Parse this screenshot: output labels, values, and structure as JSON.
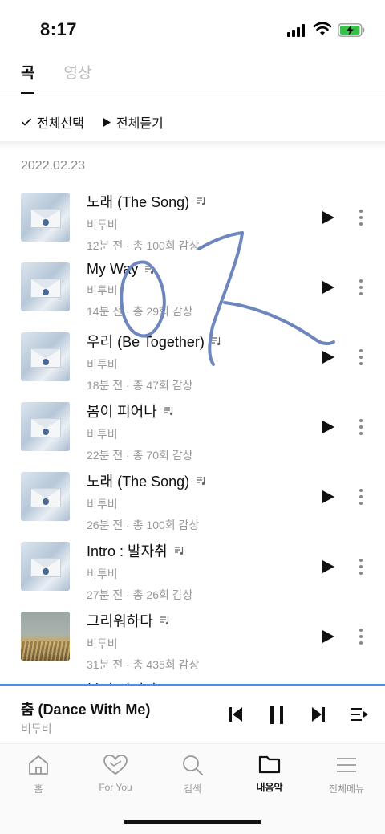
{
  "status_bar": {
    "time": "8:17"
  },
  "tabs": [
    {
      "label": "곡",
      "active": true
    },
    {
      "label": "영상",
      "active": false
    }
  ],
  "actions": {
    "select_all": "전체선택",
    "play_all": "전체듣기"
  },
  "date_header": "2022.02.23",
  "songs": [
    {
      "title": "노래 (The Song)",
      "artist": "비투비",
      "meta": "12분 전 · 총 100회 감상",
      "cover": "envelope"
    },
    {
      "title": "My Way",
      "artist": "비투비",
      "meta": "14분 전 · 총 29회 감상",
      "cover": "envelope"
    },
    {
      "title": "우리 (Be Together)",
      "artist": "비투비",
      "meta": "18분 전 · 총 47회 감상",
      "cover": "envelope"
    },
    {
      "title": "봄이 피어나",
      "artist": "비투비",
      "meta": "22분 전 · 총 70회 감상",
      "cover": "envelope"
    },
    {
      "title": "노래 (The Song)",
      "artist": "비투비",
      "meta": "26분 전 · 총 100회 감상",
      "cover": "envelope"
    },
    {
      "title": "Intro : 발자취",
      "artist": "비투비",
      "meta": "27분 전 · 총 26회 감상",
      "cover": "envelope"
    },
    {
      "title": "그리워하다",
      "artist": "비투비",
      "meta": "31분 전 · 총 435회 감상",
      "cover": "field"
    }
  ],
  "peek_title": "봄이 피어나",
  "mini_player": {
    "title": "춤 (Dance With Me)",
    "artist": "비투비"
  },
  "nav": [
    {
      "label": "홈",
      "icon": "home-icon",
      "active": false
    },
    {
      "label": "For You",
      "icon": "heart-icon",
      "active": false
    },
    {
      "label": "검색",
      "icon": "search-icon",
      "active": false
    },
    {
      "label": "내음악",
      "icon": "folder-icon",
      "active": true
    },
    {
      "label": "전체메뉴",
      "icon": "menu-icon",
      "active": false
    }
  ],
  "colors": {
    "accent": "#4a8ff0",
    "scribble": "#6d86bd"
  }
}
